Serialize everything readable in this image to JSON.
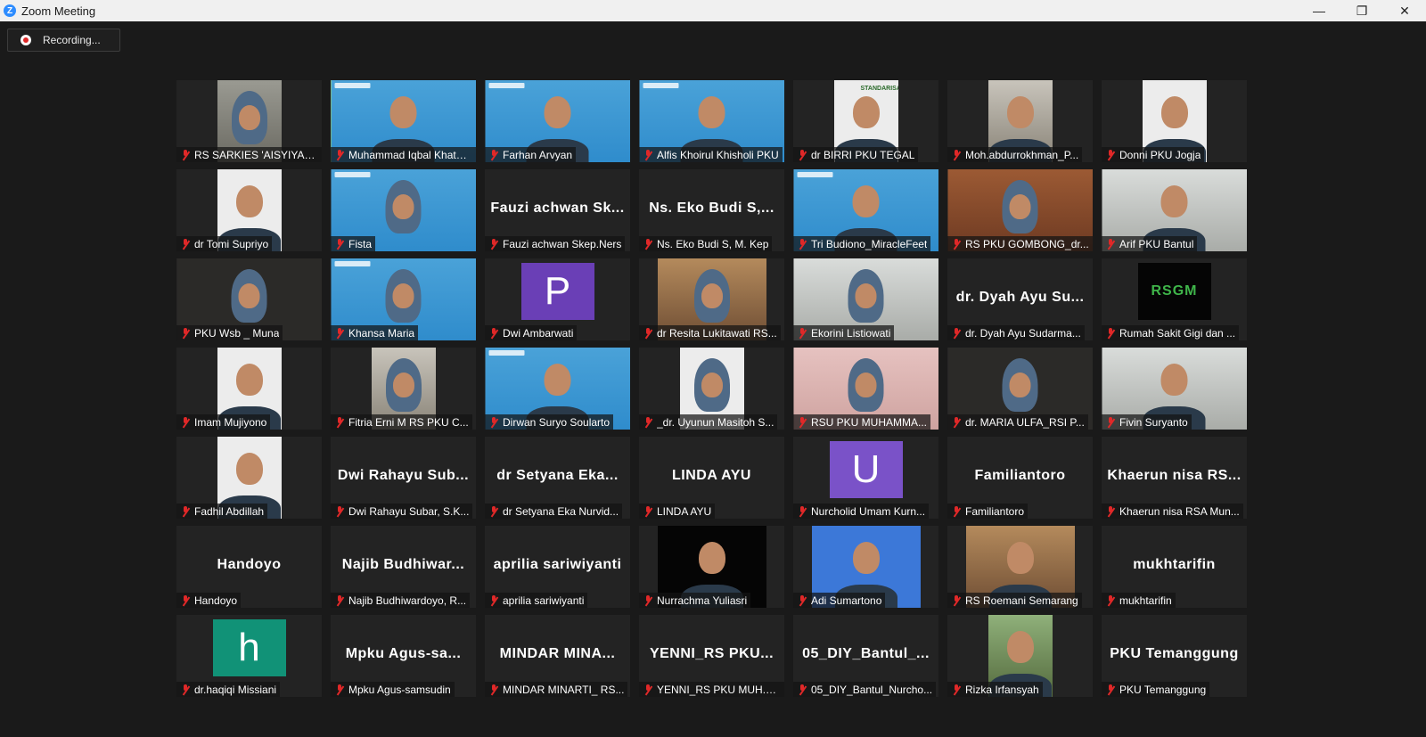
{
  "window": {
    "title": "Zoom Meeting",
    "minimize": "—",
    "maximize": "❐",
    "close": "✕"
  },
  "recording": {
    "label": "Recording..."
  },
  "participants": [
    {
      "name": "RS SARKIES 'AISYIYAH ...",
      "video": "room"
    },
    {
      "name": "Muhammad Iqbal Khatami",
      "video": "banner",
      "active": true
    },
    {
      "name": "Farhan Arvyan",
      "video": "banner"
    },
    {
      "name": "Alfis Khoirul Khisholi PKU",
      "video": "banner"
    },
    {
      "name": "dr BIRRI PKU TEGAL",
      "video": "white",
      "banner_text": "STANDARISASI DAN NEGOSIASI"
    },
    {
      "name": "Moh.abdurrokhman_P...",
      "video": "room2"
    },
    {
      "name": "Donni PKU Jogja",
      "video": "white"
    },
    {
      "name": "dr Tomi Supriyo",
      "video": "white"
    },
    {
      "name": "Fista",
      "video": "banner"
    },
    {
      "name": "Fauzi achwan Skep.Ners",
      "big": "Fauzi achwan Sk..."
    },
    {
      "name": "Ns. Eko Budi S, M. Kep",
      "big": "Ns. Eko Budi S,..."
    },
    {
      "name": "Tri Budiono_MiracleFeet",
      "video": "banner"
    },
    {
      "name": "RS PKU GOMBONG_dr...",
      "video": "brick"
    },
    {
      "name": "Arif PKU Bantul",
      "video": "office"
    },
    {
      "name": "PKU Wsb _ Muna",
      "video": "dark"
    },
    {
      "name": "Khansa Maria",
      "video": "banner"
    },
    {
      "name": "Dwi Ambarwati",
      "letter": "P",
      "letter_bg": "av-purple"
    },
    {
      "name": "dr Resita Lukitawati RS...",
      "video": "warm"
    },
    {
      "name": "Ekorini Listiowati",
      "video": "office"
    },
    {
      "name": "dr. Dyah Ayu Sudarma...",
      "big": "dr. Dyah Ayu Su..."
    },
    {
      "name": "Rumah Sakit Gigi dan ...",
      "logo": "RSGM"
    },
    {
      "name": "Imam Mujiyono",
      "video": "white"
    },
    {
      "name": "Fitria Erni M RS PKU C...",
      "video": "room2"
    },
    {
      "name": "Dirwan Suryo Soularto",
      "video": "banner"
    },
    {
      "name": "_dr. Uyunun Masitoh S...",
      "video": "white"
    },
    {
      "name": "RSU PKU MUHAMMA...",
      "video": "pink"
    },
    {
      "name": "dr. MARIA ULFA_RSI P...",
      "video": "dark"
    },
    {
      "name": "Fivin Suryanto",
      "video": "office"
    },
    {
      "name": "Fadhil Abdillah",
      "video": "white"
    },
    {
      "name": "Dwi Rahayu Subar, S.K...",
      "big": "Dwi Rahayu Sub..."
    },
    {
      "name": "dr Setyana Eka Nurvid...",
      "big": "dr Setyana Eka..."
    },
    {
      "name": "LINDA AYU",
      "big": "LINDA AYU"
    },
    {
      "name": "Nurcholid Umam Kurn...",
      "letter": "U",
      "letter_bg": "av-violet"
    },
    {
      "name": "Familiantoro",
      "big": "Familiantoro"
    },
    {
      "name": "Khaerun nisa RSA Mun...",
      "big": "Khaerun nisa RS..."
    },
    {
      "name": "Handoyo",
      "big": "Handoyo"
    },
    {
      "name": "Najib Budhiwardoyo, R...",
      "big": "Najib Budhiwar..."
    },
    {
      "name": "aprilia sariwiyanti",
      "big": "aprilia sariwiyanti"
    },
    {
      "name": "Nurrachma Yuliasri",
      "video": "black"
    },
    {
      "name": "Adi Sumartono",
      "video": "blue"
    },
    {
      "name": "RS Roemani Semarang",
      "video": "warm"
    },
    {
      "name": "mukhtarifin",
      "big": "mukhtarifin"
    },
    {
      "name": "dr.haqiqi Missiani",
      "letter": "h",
      "letter_bg": "av-teal"
    },
    {
      "name": "Mpku Agus-samsudin",
      "big": "Mpku Agus-sa..."
    },
    {
      "name": "MINDAR MINARTI_ RS...",
      "big": "MINDAR MINA..."
    },
    {
      "name": "YENNI_RS PKU MUH.S...",
      "big": "YENNI_RS PKU..."
    },
    {
      "name": "05_DIY_Bantul_Nurcho...",
      "big": "05_DIY_Bantul_..."
    },
    {
      "name": "Rizka Irfansyah",
      "video": "green"
    },
    {
      "name": "PKU Temanggung",
      "big": "PKU Temanggung"
    }
  ]
}
